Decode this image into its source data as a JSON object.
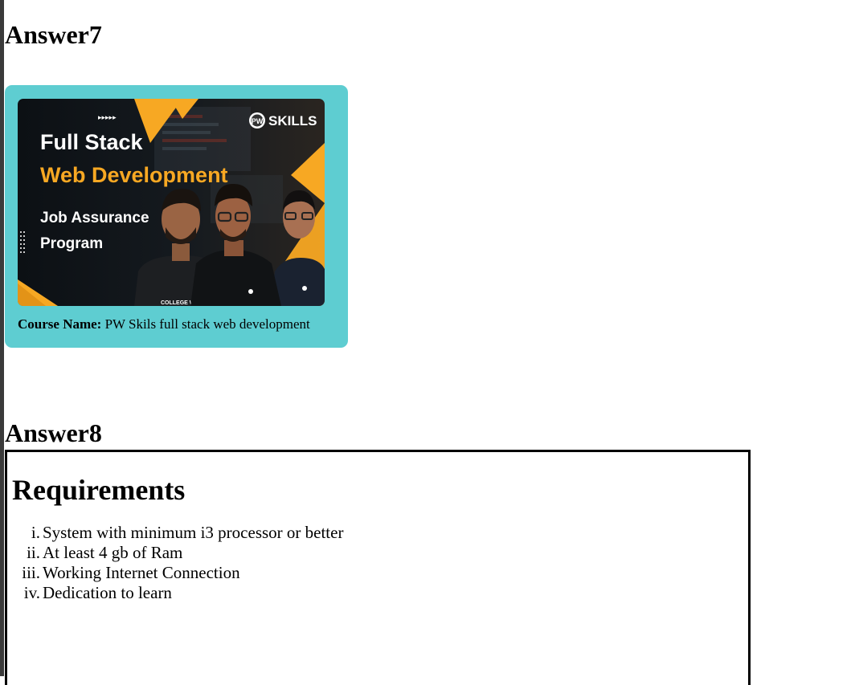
{
  "answer7": {
    "heading": "Answer7",
    "card": {
      "image": {
        "title_line1": "Full Stack",
        "title_line2": "Web Development",
        "subtitle_line1": "Job Assurance",
        "subtitle_line2": "Program",
        "brand": "SKILLS",
        "brand_badge": "PW",
        "shirt_text": "COLLEGE W",
        "colors": {
          "background": "#101418",
          "accent": "#f7a823",
          "title": "#ffffff"
        }
      },
      "caption_label": "Course Name:",
      "caption_value": " PW Skils full stack web development",
      "background_color": "#5ecdd1"
    }
  },
  "answer8": {
    "heading": "Answer8",
    "box": {
      "title": "Requirements",
      "items": [
        {
          "marker": "i.",
          "text": "System with minimum i3 processor or better"
        },
        {
          "marker": "ii.",
          "text": "At least 4 gb of Ram"
        },
        {
          "marker": "iii.",
          "text": "Working Internet Connection"
        },
        {
          "marker": "iv.",
          "text": "Dedication to learn"
        }
      ]
    }
  }
}
